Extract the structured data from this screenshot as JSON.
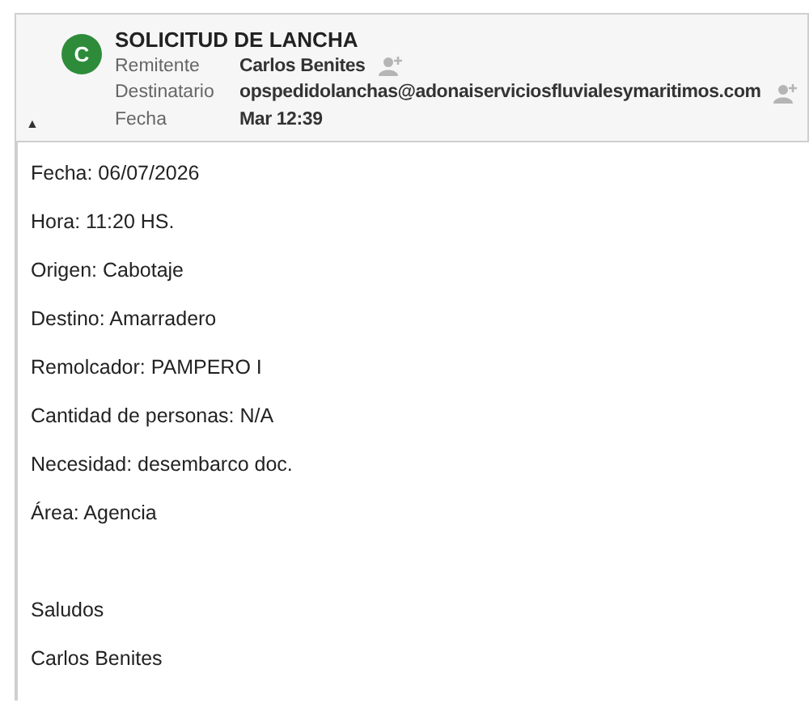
{
  "header": {
    "avatar": "C",
    "subject": "SOLICITUD DE LANCHA",
    "collapse_icon": "▲",
    "fields": [
      {
        "label": "Remitente",
        "value": "Carlos Benites",
        "add_contact": true
      },
      {
        "label": "Destinatario",
        "value": "opspedidolanchas@adonaiserviciosfluvialesymaritimos.com",
        "add_contact": true
      },
      {
        "label": "Fecha",
        "value": "Mar 12:39",
        "add_contact": false
      }
    ]
  },
  "body": {
    "blocks": [
      [
        "Fecha: 06/07/2026",
        "Hora: 11:20 HS.",
        "Origen: Cabotaje",
        "Destino: Amarradero",
        "Remolcador: PAMPERO I",
        "Cantidad de personas: N/A",
        "Necesidad: desembarco doc.",
        "Área: Agencia"
      ],
      [
        "Saludos",
        "Carlos Benites"
      ]
    ]
  }
}
